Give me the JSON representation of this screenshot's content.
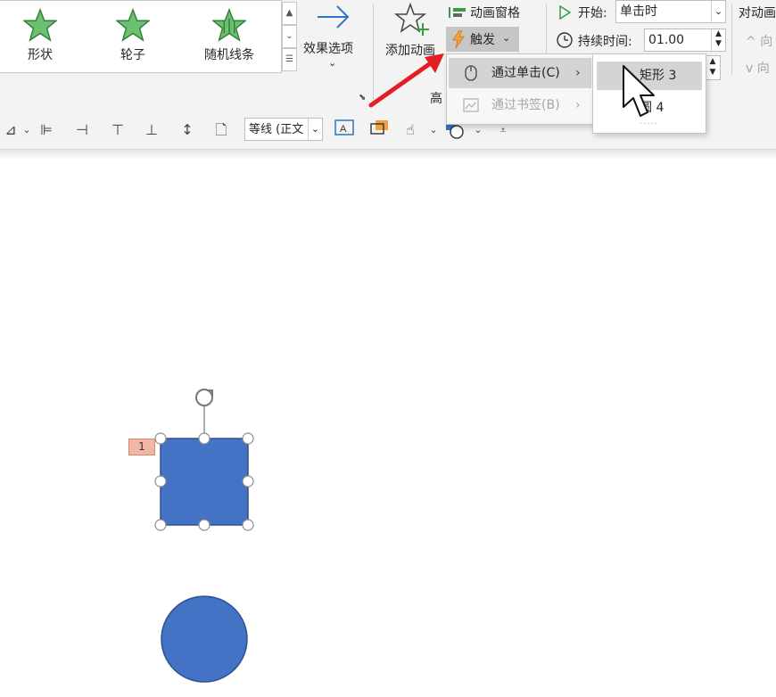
{
  "ribbon": {
    "gallery": [
      {
        "label": "形状",
        "icon": "star-icon"
      },
      {
        "label": "轮子",
        "icon": "star-icon"
      },
      {
        "label": "随机线条",
        "icon": "star-icon"
      }
    ],
    "effect_options": "效果选项",
    "add_animation": "添加动画",
    "animation_pane": "动画窗格",
    "trigger": "触发",
    "advanced_group_partial": "高",
    "start_label": "开始:",
    "start_value": "单击时",
    "duration_label": "持续时间:",
    "duration_value": "01.00",
    "reorder_title": "对动画",
    "move_earlier": "向",
    "move_later": "向"
  },
  "trigger_menu": {
    "items": [
      {
        "label": "通过单击(C)",
        "icon": "mouse-icon",
        "enabled": true
      },
      {
        "label": "通过书签(B)",
        "icon": "bookmark-icon",
        "enabled": false
      }
    ]
  },
  "submenu": {
    "items": [
      {
        "label": "矩形 3"
      },
      {
        "label": "圆 4"
      }
    ],
    "more": "....."
  },
  "toolbar": {
    "font_value": "等线 (正文"
  },
  "slide": {
    "animation_badge": "1",
    "square_color": "#4472c4",
    "circle_color": "#4472c4"
  },
  "colors": {
    "accent_star": "#3a9a45",
    "arrow_red": "#e41e25",
    "ribbon_bg": "#f3f3f3"
  }
}
